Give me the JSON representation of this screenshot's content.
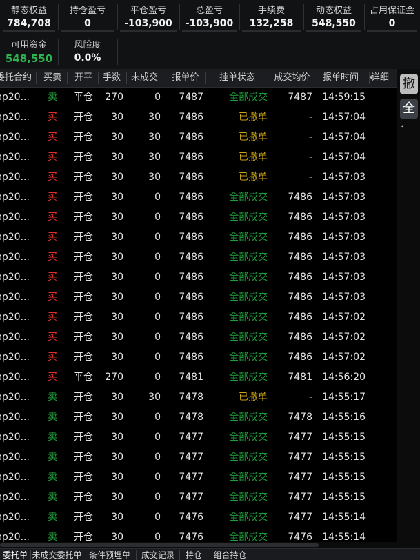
{
  "summary": {
    "stats_row1": [
      {
        "label": "静态权益",
        "value": "784,708"
      },
      {
        "label": "持仓盈亏",
        "value": "0"
      },
      {
        "label": "平仓盈亏",
        "value": "-103,900"
      },
      {
        "label": "总盈亏",
        "value": "-103,900"
      },
      {
        "label": "手续费",
        "value": "132,258"
      },
      {
        "label": "动态权益",
        "value": "548,550"
      },
      {
        "label": "占用保证金",
        "value": "0"
      }
    ],
    "stats_row2": [
      {
        "label": "可用资金",
        "value": "548,550"
      },
      {
        "label": "风险度",
        "value": "0.0%"
      }
    ]
  },
  "table": {
    "headers": [
      "委托合约",
      "买卖",
      "开平",
      "手数",
      "未成交",
      "报单价",
      "挂单状态",
      "成交均价",
      "报单时间",
      "详细"
    ],
    "sort_indicator": "▾",
    "rows": [
      [
        "pp20...",
        "卖",
        "平仓",
        "270",
        "0",
        "7487",
        "全部成交",
        "7487",
        "14:59:15"
      ],
      [
        "pp20...",
        "买",
        "开仓",
        "30",
        "30",
        "7486",
        "已撤单",
        "-",
        "14:57:04"
      ],
      [
        "pp20...",
        "买",
        "开仓",
        "30",
        "30",
        "7486",
        "已撤单",
        "-",
        "14:57:04"
      ],
      [
        "pp20...",
        "买",
        "开仓",
        "30",
        "30",
        "7486",
        "已撤单",
        "-",
        "14:57:04"
      ],
      [
        "pp20...",
        "买",
        "开仓",
        "30",
        "30",
        "7486",
        "已撤单",
        "-",
        "14:57:03"
      ],
      [
        "pp20...",
        "买",
        "开仓",
        "30",
        "0",
        "7486",
        "全部成交",
        "7486",
        "14:57:03"
      ],
      [
        "pp20...",
        "买",
        "开仓",
        "30",
        "0",
        "7486",
        "全部成交",
        "7486",
        "14:57:03"
      ],
      [
        "pp20...",
        "买",
        "开仓",
        "30",
        "0",
        "7486",
        "全部成交",
        "7486",
        "14:57:03"
      ],
      [
        "pp20...",
        "买",
        "开仓",
        "30",
        "0",
        "7486",
        "全部成交",
        "7486",
        "14:57:03"
      ],
      [
        "pp20...",
        "买",
        "开仓",
        "30",
        "0",
        "7486",
        "全部成交",
        "7486",
        "14:57:03"
      ],
      [
        "pp20...",
        "买",
        "开仓",
        "30",
        "0",
        "7486",
        "全部成交",
        "7486",
        "14:57:03"
      ],
      [
        "pp20...",
        "买",
        "开仓",
        "30",
        "0",
        "7486",
        "全部成交",
        "7486",
        "14:57:02"
      ],
      [
        "pp20...",
        "买",
        "开仓",
        "30",
        "0",
        "7486",
        "全部成交",
        "7486",
        "14:57:02"
      ],
      [
        "pp20...",
        "买",
        "开仓",
        "30",
        "0",
        "7486",
        "全部成交",
        "7486",
        "14:57:02"
      ],
      [
        "pp20...",
        "买",
        "平仓",
        "270",
        "0",
        "7481",
        "全部成交",
        "7481",
        "14:56:20"
      ],
      [
        "pp20...",
        "卖",
        "开仓",
        "30",
        "30",
        "7478",
        "已撤单",
        "-",
        "14:55:17"
      ],
      [
        "pp20...",
        "卖",
        "开仓",
        "30",
        "0",
        "7478",
        "全部成交",
        "7478",
        "14:55:16"
      ],
      [
        "pp20...",
        "卖",
        "开仓",
        "30",
        "0",
        "7477",
        "全部成交",
        "7477",
        "14:55:15"
      ],
      [
        "pp20...",
        "卖",
        "开仓",
        "30",
        "0",
        "7477",
        "全部成交",
        "7477",
        "14:55:15"
      ],
      [
        "pp20...",
        "卖",
        "开仓",
        "30",
        "0",
        "7477",
        "全部成交",
        "7477",
        "14:55:15"
      ],
      [
        "pp20...",
        "卖",
        "开仓",
        "30",
        "0",
        "7477",
        "全部成交",
        "7477",
        "14:55:15"
      ],
      [
        "pp20...",
        "卖",
        "开仓",
        "30",
        "0",
        "7476",
        "全部成交",
        "7477",
        "14:55:14"
      ],
      [
        "pp20...",
        "卖",
        "开仓",
        "30",
        "0",
        "7476",
        "全部成交",
        "7476",
        "14:55:14"
      ]
    ]
  },
  "side_buttons": {
    "cancel": "撤",
    "all": "全",
    "arrow": "◂"
  },
  "bottom_tabs": [
    "委托单",
    "未成交委托单",
    "条件预埋单",
    "成交记录",
    "持仓",
    "组合持仓"
  ],
  "colors": {
    "buy": "#e0302a",
    "sell": "#22a33c",
    "filled": "#1f9a3a",
    "cancelled": "#c9a317",
    "available": "#2fb350"
  }
}
